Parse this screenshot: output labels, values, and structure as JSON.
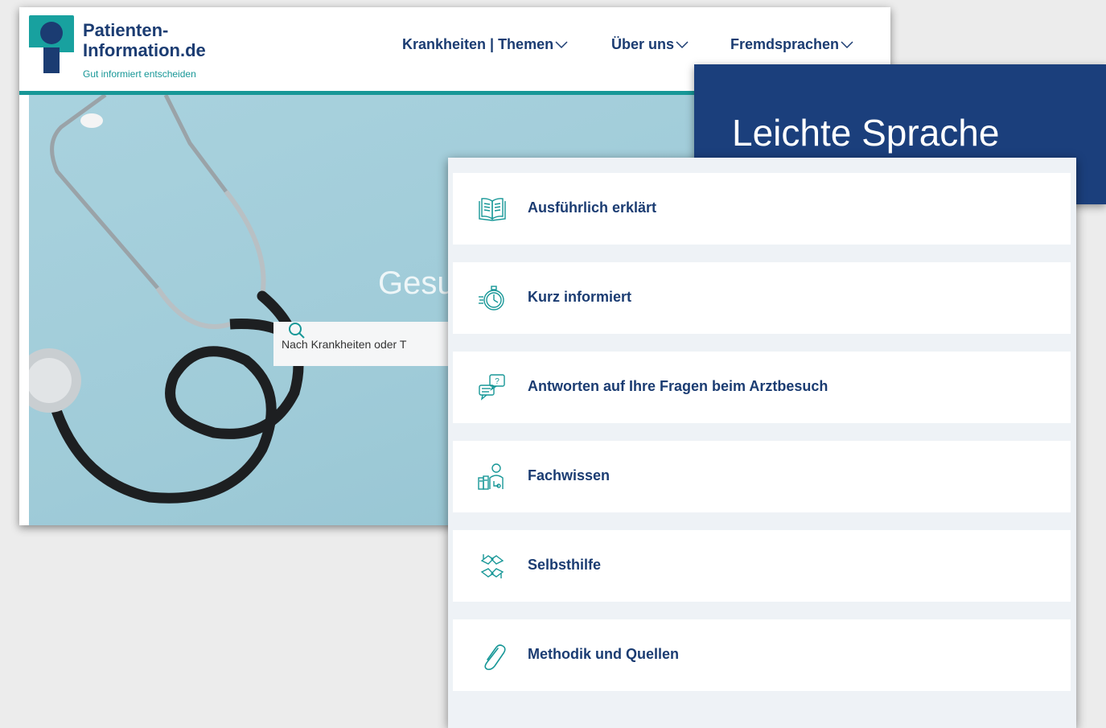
{
  "logo": {
    "line1": "Patienten-",
    "line2": "Information.de",
    "tagline": "Gut informiert entscheiden"
  },
  "nav": {
    "items": [
      {
        "label": "Krankheiten | Themen",
        "icon": "chevron-down-icon"
      },
      {
        "label": "Über uns",
        "icon": "chevron-down-icon"
      },
      {
        "label": "Fremdsprachen",
        "icon": "chevron-down-icon"
      }
    ]
  },
  "hero": {
    "title": "Gesu",
    "search_placeholder": "Nach Krankheiten oder T"
  },
  "banner": {
    "title": "Leichte Sprache"
  },
  "menu": {
    "items": [
      {
        "label": "Ausführlich erklärt",
        "icon": "book-icon"
      },
      {
        "label": "Kurz informiert",
        "icon": "stopwatch-icon"
      },
      {
        "label": "Antworten auf Ihre Fragen beim Arztbesuch",
        "icon": "question-chat-icon"
      },
      {
        "label": "Fachwissen",
        "icon": "doctor-books-icon"
      },
      {
        "label": "Selbsthilfe",
        "icon": "helping-hands-icon"
      },
      {
        "label": "Methodik und Quellen",
        "icon": "paperclip-icon"
      }
    ]
  },
  "colors": {
    "brand_blue": "#1b3c72",
    "teal": "#179797",
    "banner_blue": "#1b3f7c"
  }
}
